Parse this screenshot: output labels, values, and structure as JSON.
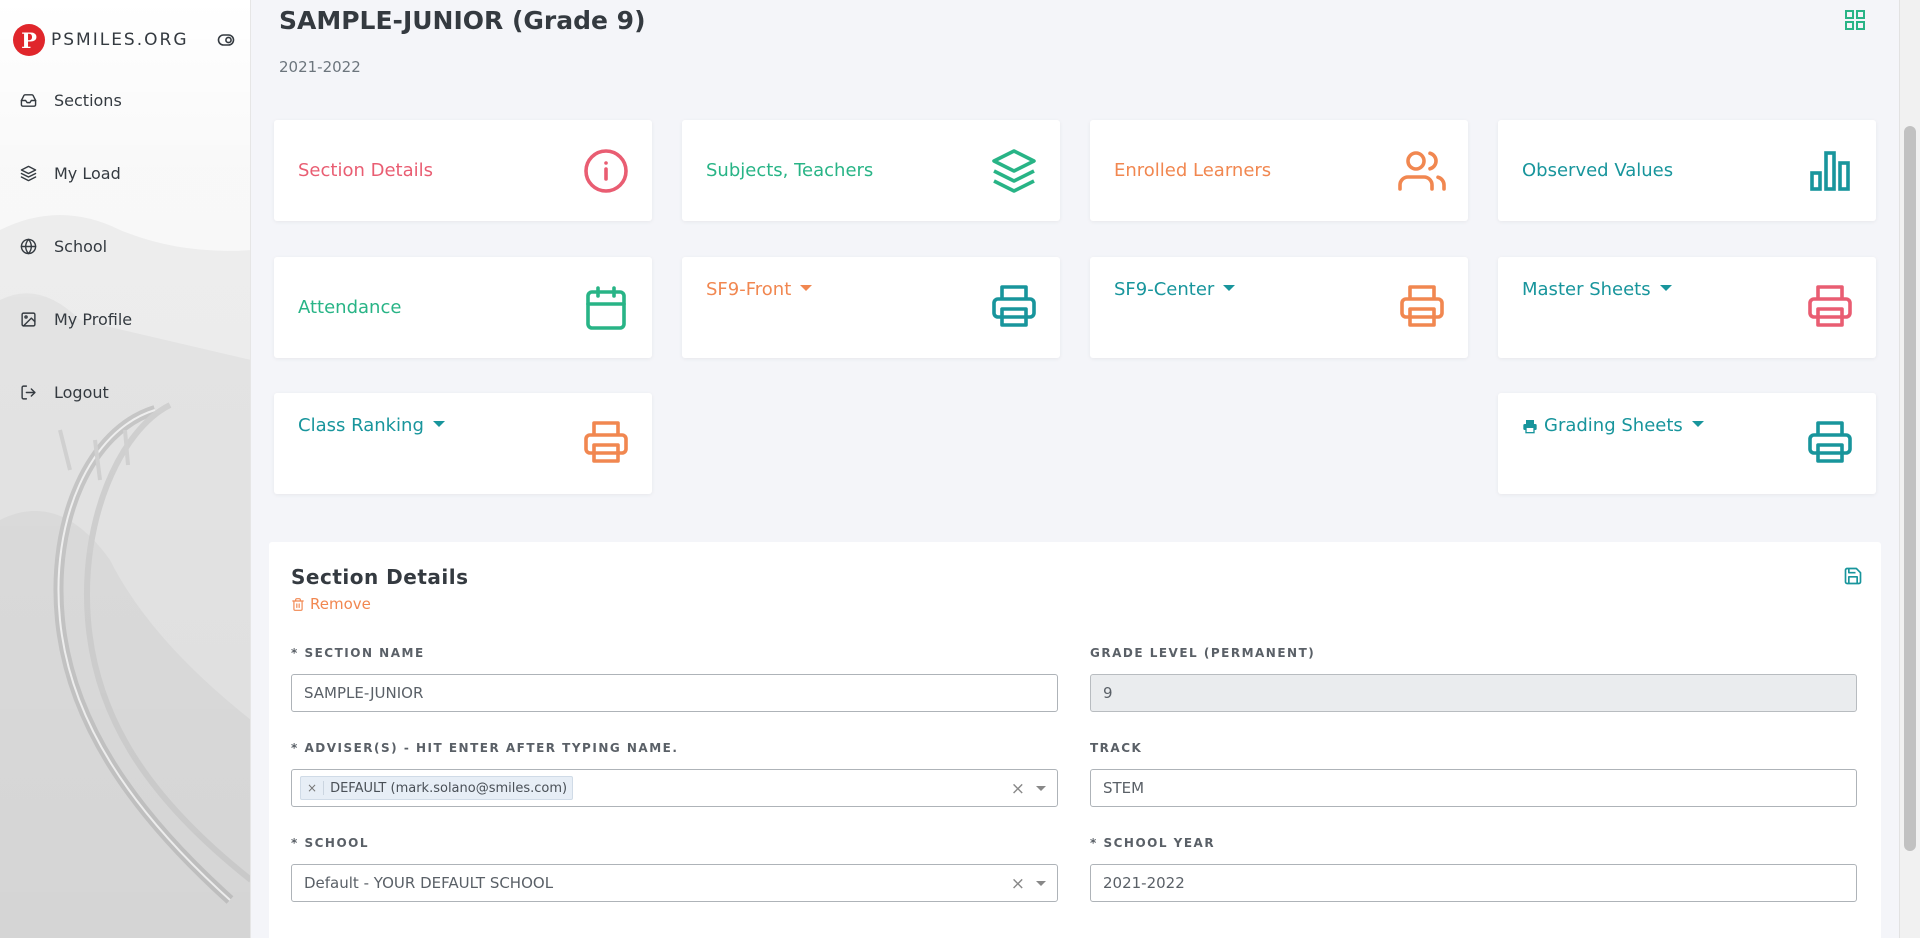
{
  "brand": {
    "initial": "P",
    "name": "PSMILES.ORG"
  },
  "sidebar": {
    "items": [
      {
        "label": "Sections",
        "icon": "inbox-icon"
      },
      {
        "label": "My Load",
        "icon": "layers-icon"
      },
      {
        "label": "School",
        "icon": "globe-icon"
      },
      {
        "label": "My Profile",
        "icon": "image-icon"
      },
      {
        "label": "Logout",
        "icon": "logout-icon"
      }
    ]
  },
  "header": {
    "title": "SAMPLE-JUNIOR (Grade 9)",
    "school_year": "2021-2022"
  },
  "cards": [
    {
      "label": "Section Details",
      "color": "#e95d72",
      "icon": "info-icon",
      "dropdown": false
    },
    {
      "label": "Subjects, Teachers",
      "color": "#28b486",
      "icon": "layers-icon",
      "dropdown": false
    },
    {
      "label": "Enrolled Learners",
      "color": "#f18750",
      "icon": "users-icon",
      "dropdown": false
    },
    {
      "label": "Observed Values",
      "color": "#18959c",
      "icon": "bar-chart-icon",
      "dropdown": false
    },
    {
      "label": "Attendance",
      "color": "#28b486",
      "icon": "calendar-icon",
      "dropdown": false
    },
    {
      "label": "SF9-Front",
      "color": "#f18750",
      "icon": "printer-icon",
      "icon_color": "#18959c",
      "dropdown": true
    },
    {
      "label": "SF9-Center",
      "color": "#18959c",
      "icon": "printer-icon",
      "icon_color": "#f18750",
      "dropdown": true
    },
    {
      "label": "Master Sheets",
      "color": "#18959c",
      "icon": "printer-icon",
      "icon_color": "#e95d72",
      "dropdown": true
    },
    {
      "label": "Class Ranking",
      "color": "#18959c",
      "icon": "printer-icon",
      "icon_color": "#f18750",
      "dropdown": true
    },
    {
      "label": "Grading Sheets",
      "color": "#18959c",
      "icon": "printer-icon",
      "icon_color": "#18959c",
      "dropdown": true
    }
  ],
  "panel": {
    "title": "Section Details",
    "remove_label": "Remove",
    "fields": {
      "section_name": {
        "label": "* SECTION NAME",
        "value": "SAMPLE-JUNIOR"
      },
      "grade_level": {
        "label": "GRADE LEVEL (PERMANENT)",
        "value": "9"
      },
      "advisers": {
        "label": "* ADVISER(S) - HIT ENTER AFTER TYPING NAME.",
        "tag": "DEFAULT (mark.solano@smiles.com)"
      },
      "track": {
        "label": "TRACK",
        "value": "STEM"
      },
      "school": {
        "label": "* SCHOOL",
        "value": "Default - YOUR DEFAULT SCHOOL"
      },
      "school_year": {
        "label": "* SCHOOL YEAR",
        "value": "2021-2022"
      }
    }
  },
  "colors": {
    "teal": "#18959c",
    "green": "#28b486",
    "orange": "#f18750",
    "red": "#e95d72",
    "brand_red": "#e0262b"
  }
}
